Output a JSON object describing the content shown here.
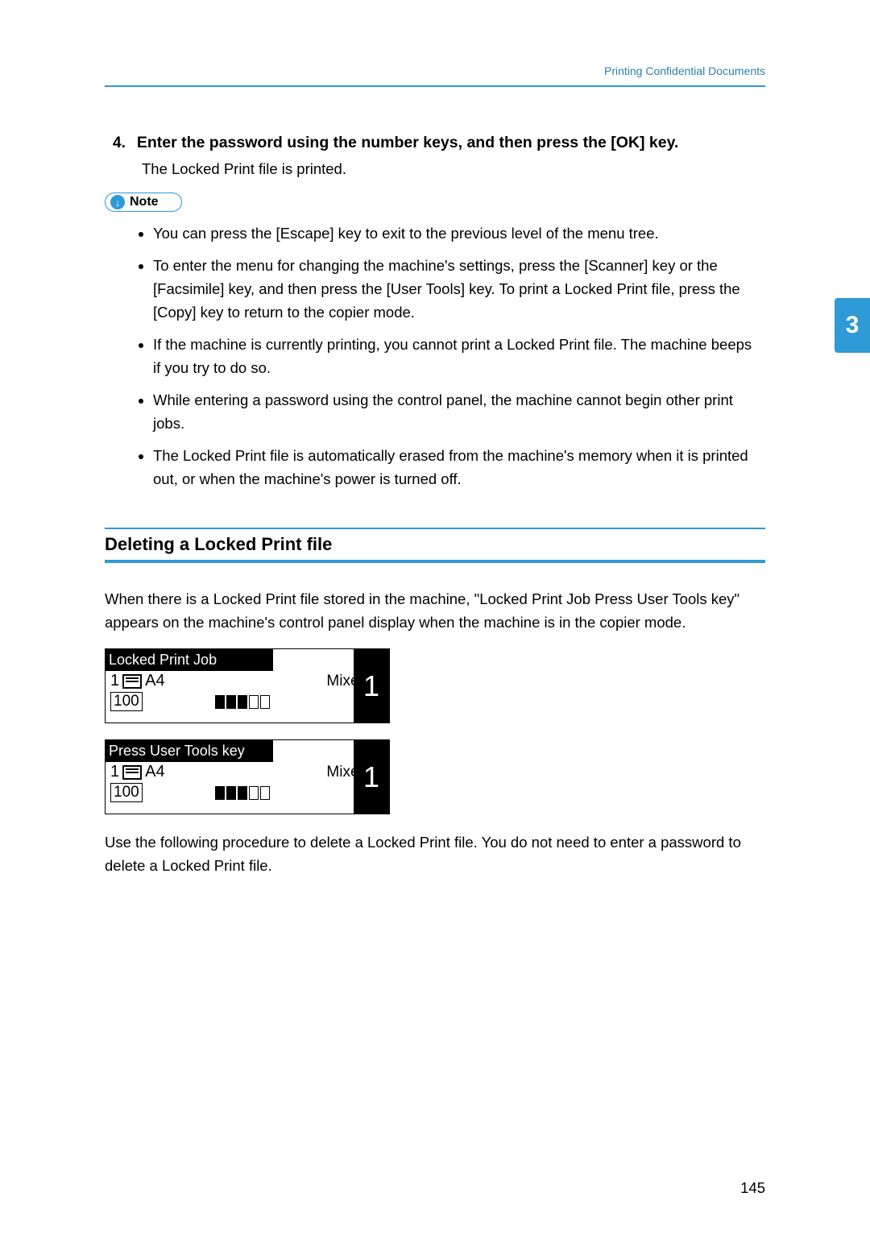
{
  "header": {
    "section_title": "Printing Confidential Documents"
  },
  "step": {
    "number": "4.",
    "text": "Enter the password using the number keys, and then press the [OK] key.",
    "result": "The Locked Print file is printed."
  },
  "note": {
    "label": "Note",
    "bullets": [
      "You can press the [Escape] key to exit to the previous level of the menu tree.",
      "To enter the menu for changing the machine's settings, press the [Scanner] key or the [Facsimile] key, and then press the [User Tools] key. To print a Locked Print file, press the [Copy] key to return to the copier mode.",
      "If the machine is currently printing, you cannot print a Locked Print file. The machine beeps if you try to do so.",
      "While entering a password using the control panel, the machine cannot begin other print jobs.",
      "The Locked Print file is automatically erased from the machine's memory when it is printed out, or when the machine's power is turned off."
    ]
  },
  "section": {
    "heading": "Deleting a Locked Print file",
    "intro": "When there is a Locked Print file stored in the machine, \"Locked Print Job Press User Tools key\" appears on the machine's control panel display when the machine is in the copier mode.",
    "outro": "Use the following procedure to delete a Locked Print file. You do not need to enter a password to delete a Locked Print file."
  },
  "panel1": {
    "title": "Locked Print Job",
    "tray_num": "1",
    "paper": "A4",
    "mixed": "Mixed",
    "ratio": "100",
    "copies": "1"
  },
  "panel2": {
    "title": "Press User Tools key",
    "tray_num": "1",
    "paper": "A4",
    "mixed": "Mixed",
    "ratio": "100",
    "copies": "1"
  },
  "chapter_tab": "3",
  "page_number": "145"
}
